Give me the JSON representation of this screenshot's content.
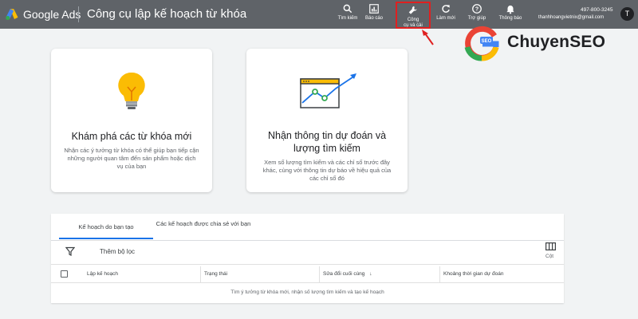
{
  "topbar": {
    "brand": "Google Ads",
    "page_title": "Công cụ lập kế hoạch từ khóa",
    "tools": [
      {
        "icon": "search-icon",
        "label": "Tìm kiếm"
      },
      {
        "icon": "chart-icon",
        "label": "Báo cáo"
      },
      {
        "icon": "wrench-icon",
        "label": "Công\ncụ và cài"
      },
      {
        "icon": "refresh-icon",
        "label": "Làm mới"
      },
      {
        "icon": "help-icon",
        "label": "Trợ giúp"
      },
      {
        "icon": "bell-icon",
        "label": "Thông báo"
      }
    ],
    "account_id": "497-800-3245",
    "account_email": "thanhhoangvietnix@gmail.com",
    "avatar_letter": "T"
  },
  "watermark": {
    "text": "ChuyenSEO",
    "logo_label": "SEO"
  },
  "cards": {
    "discover": {
      "title": "Khám phá các từ khóa mới",
      "desc": "Nhận các ý tưởng từ khóa có thể giúp bạn tiếp cận những người quan tâm đến sản phẩm hoặc dịch vụ của bạn"
    },
    "forecast": {
      "title": "Nhận thông tin dự đoán và lượng tìm kiếm",
      "desc": "Xem số lượng tìm kiếm và các chỉ số trước đây khác, cùng với thông tin dự báo về hiệu quả của các chỉ số đó"
    }
  },
  "plans": {
    "tabs": [
      "Kế hoạch do bạn tạo",
      "Các kế hoạch được chia sẻ với bạn"
    ],
    "filter_label": "Thêm bộ lọc",
    "columns_label": "Cột",
    "columns": [
      "Lập kế hoạch",
      "Trạng thái",
      "Sửa đổi cuối cùng",
      "Khoảng thời gian dự đoán"
    ],
    "sort_indicator": "↓",
    "empty_message": "Tìm ý tưởng từ khóa mới, nhận số lượng tìm kiếm và tạo kế hoạch"
  },
  "colors": {
    "topbar": "#5f6368",
    "accent": "#1a73e8",
    "highlight": "#e02020"
  }
}
